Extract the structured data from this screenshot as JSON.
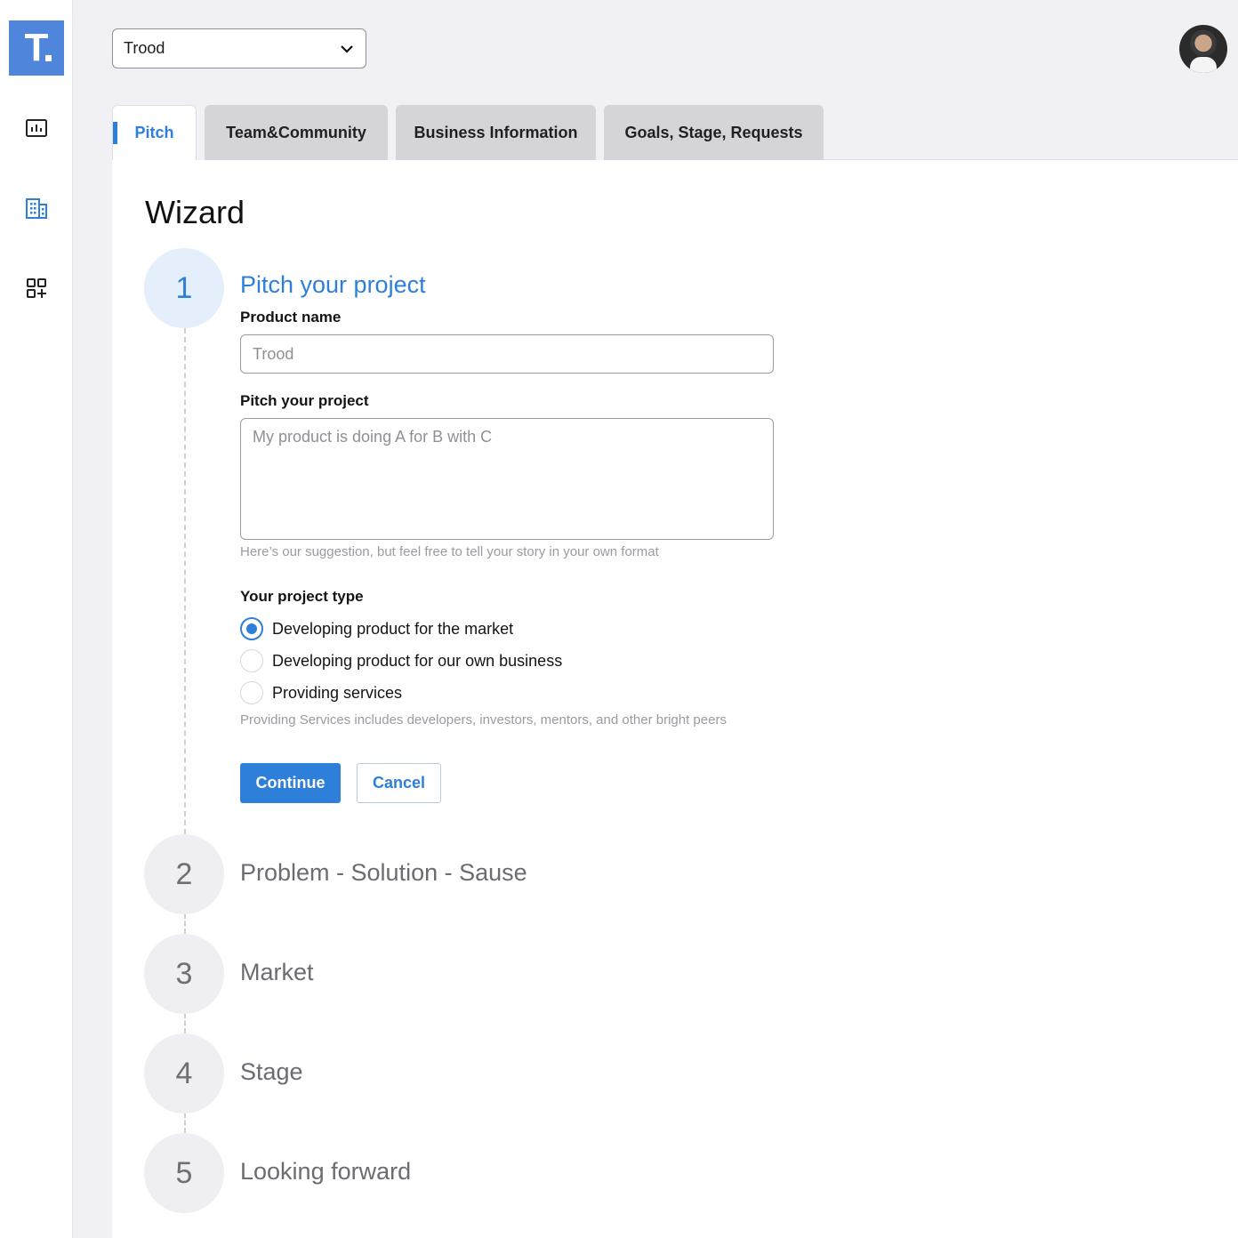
{
  "app": {
    "logo_letter": "T",
    "brand_color": "#4f86dc",
    "accent_color": "#2d7fd9"
  },
  "sidebar": {
    "items": [
      {
        "icon": "analytics-icon"
      },
      {
        "icon": "building-icon"
      },
      {
        "icon": "add-widget-icon"
      }
    ]
  },
  "header": {
    "project_select_value": "Trood",
    "avatar": "user-avatar"
  },
  "tabs": [
    {
      "label": "Pitch",
      "active": true
    },
    {
      "label": "Team&Community",
      "active": false
    },
    {
      "label": "Business Information",
      "active": false
    },
    {
      "label": "Goals, Stage, Requests",
      "active": false
    }
  ],
  "wizard": {
    "title": "Wizard",
    "steps": [
      {
        "number": "1",
        "title": "Pitch your project",
        "active": true
      },
      {
        "number": "2",
        "title": "Problem - Solution - Sause",
        "active": false
      },
      {
        "number": "3",
        "title": "Market",
        "active": false
      },
      {
        "number": "4",
        "title": "Stage",
        "active": false
      },
      {
        "number": "5",
        "title": "Looking forward",
        "active": false
      }
    ]
  },
  "form": {
    "product_name_label": "Product name",
    "product_name_placeholder": "Trood",
    "pitch_label": "Pitch your project",
    "pitch_placeholder": "My product is doing A for B with C",
    "pitch_hint": "Here’s our suggestion, but feel free to tell your story in your own format",
    "project_type_label": "Your project type",
    "project_types": [
      {
        "label": "Developing product for the market",
        "checked": true
      },
      {
        "label": "Developing product for our own business",
        "checked": false
      },
      {
        "label": "Providing services",
        "checked": false
      }
    ],
    "project_type_hint": "Providing Services includes developers, investors, mentors, and other bright peers",
    "continue_label": "Continue",
    "cancel_label": "Cancel"
  }
}
